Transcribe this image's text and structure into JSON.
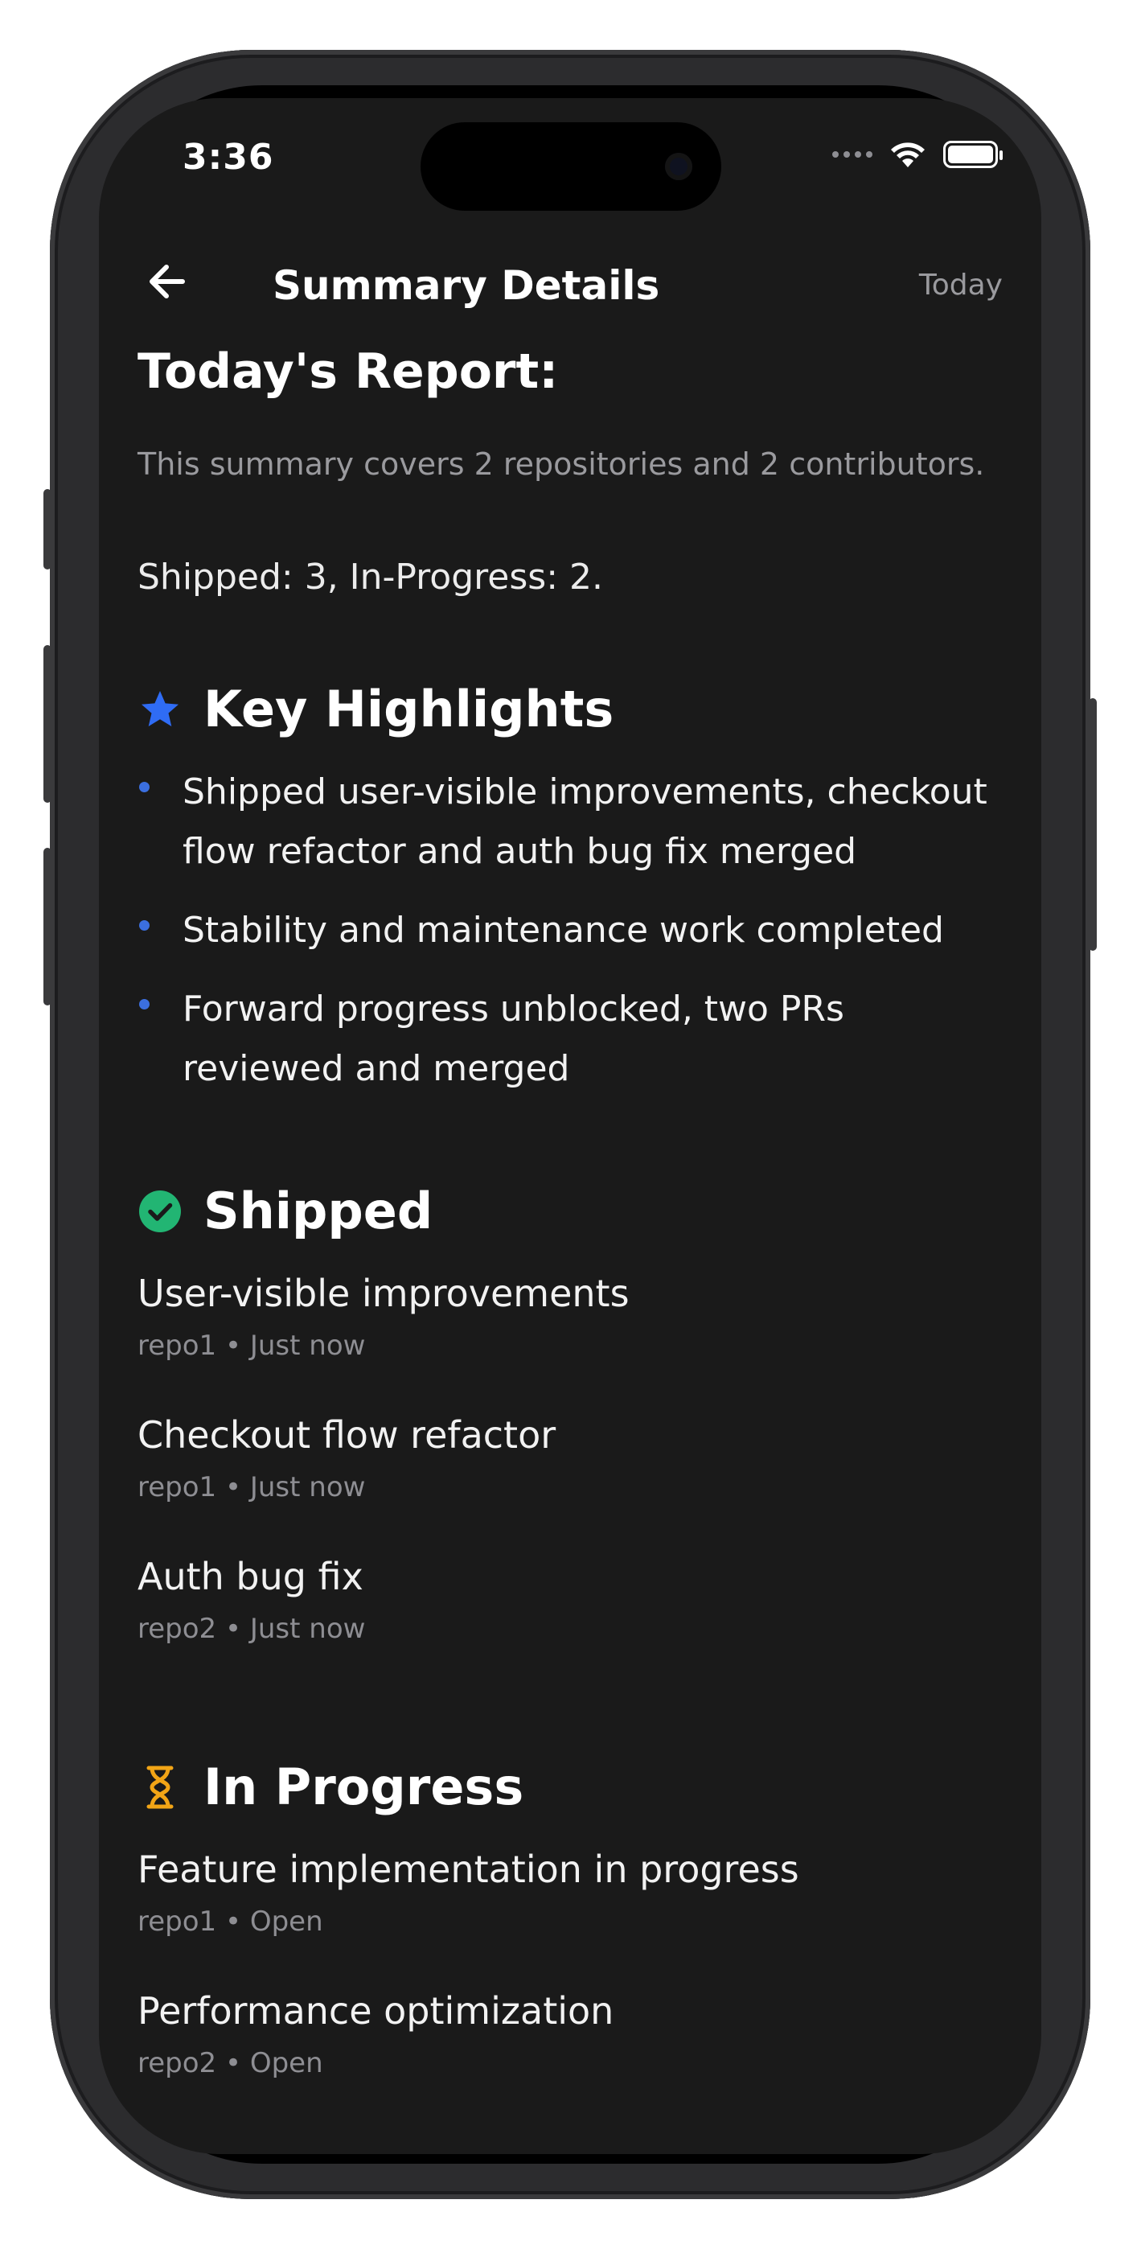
{
  "status": {
    "time": "3:36"
  },
  "nav": {
    "title": "Summary Details",
    "right_label": "Today"
  },
  "report": {
    "title": "Today's Report:",
    "subtitle": "This summary covers 2 repositories and 2 contributors.",
    "stats": "Shipped: 3, In-Progress: 2."
  },
  "highlights": {
    "title": "Key Highlights",
    "icon": "star-icon",
    "accent": "#2f6cf5",
    "items": [
      "Shipped user-visible improvements, checkout flow refactor and auth bug fix merged",
      "Stability and maintenance work completed",
      "Forward progress unblocked, two PRs reviewed and merged"
    ]
  },
  "shipped": {
    "title": "Shipped",
    "icon": "check-circle-icon",
    "accent": "#22b573",
    "items": [
      {
        "title": "User-visible improvements",
        "meta": "repo1 • Just now"
      },
      {
        "title": "Checkout flow refactor",
        "meta": "repo1 • Just now"
      },
      {
        "title": "Auth bug fix",
        "meta": "repo2 • Just now"
      }
    ]
  },
  "in_progress": {
    "title": "In Progress",
    "icon": "hourglass-icon",
    "accent": "#f2a516",
    "items": [
      {
        "title": "Feature implementation in progress",
        "meta": "repo1 • Open"
      },
      {
        "title": "Performance optimization",
        "meta": "repo2 • Open"
      }
    ]
  }
}
